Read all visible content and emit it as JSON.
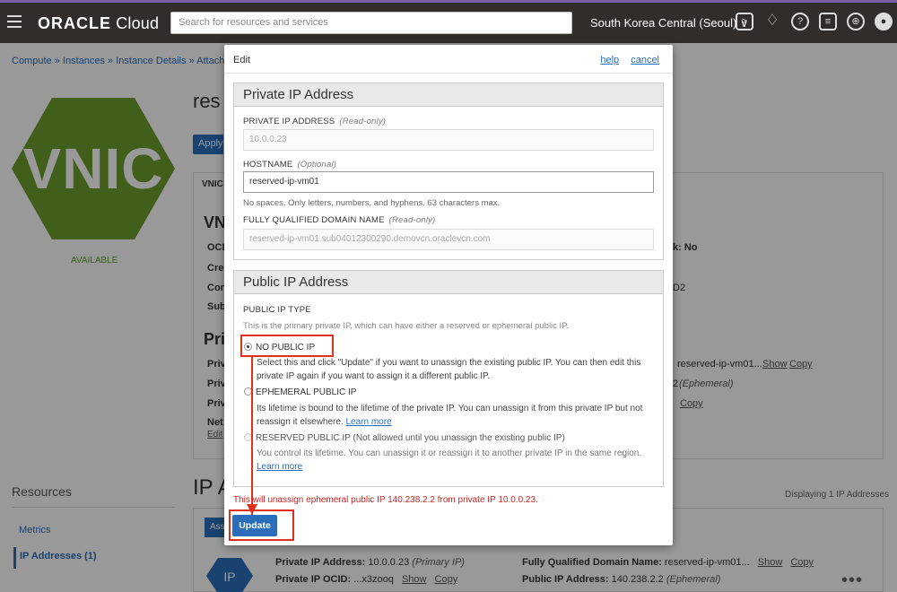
{
  "topbar": {
    "logo_brand": "ORACLE",
    "logo_product": "Cloud",
    "search_placeholder": "Search for resources and services",
    "region": "South Korea Central (Seoul) ∨",
    "icons": [
      "cloud-shell-icon",
      "bell-icon",
      "help-icon",
      "chat-icon",
      "globe-icon",
      "user-icon"
    ]
  },
  "breadcrumb": {
    "items": [
      "Compute",
      "Instances",
      "Instance Details",
      "Attached"
    ],
    "separator": "»"
  },
  "vnic": {
    "label": "VNIC",
    "status": "AVAILABLE",
    "status_color": "#5a9c2a",
    "hex_color": "#6d9e2e"
  },
  "background": {
    "title_partial": "res",
    "apply_partial": "Apply",
    "tab_partial": "VNIC",
    "section_partial": "VN",
    "rows_partial": [
      "OCI",
      "Cre",
      "Con",
      "Sub"
    ],
    "pri_heading_partial": "Pri",
    "pri_rows_partial": [
      "Priv",
      "Priv",
      "Priv"
    ],
    "net_partial": "Net",
    "edit_partial": "Edit",
    "right_k": "k:  No",
    "right_d2": "D2",
    "right_fqdn": "reserved-ip-vm01...",
    "right_ephemeral": "2",
    "ephemeral_label": "(Ephemeral)",
    "show": "Show",
    "copy": "Copy"
  },
  "resources": {
    "heading": "Resources",
    "items": [
      "Metrics",
      "IP Addresses (1)"
    ]
  },
  "ip_list": {
    "heading_partial": "IP A",
    "displaying": "Displaying 1 IP Addresses",
    "add_partial": "Ass",
    "icon_label": "IP",
    "private_ip_label": "Private IP Address:",
    "private_ip_value": "10.0.0.23",
    "private_ip_note": "(Primary IP)",
    "ocid_label": "Private IP OCID:",
    "ocid_value": "...x3zooq",
    "fqdn_label": "Fully Qualified Domain Name:",
    "fqdn_value": "reserved-ip-vm01...",
    "public_ip_label": "Public IP Address:",
    "public_ip_value": "140.238.2.2",
    "public_ip_note": "(Ephemeral)",
    "show": "Show",
    "copy": "Copy",
    "more": "•••"
  },
  "modal": {
    "title": "Edit",
    "help": "help",
    "cancel": "cancel",
    "private_section": {
      "heading": "Private IP Address",
      "ip_label": "PRIVATE IP ADDRESS",
      "ip_note": "(Read-only)",
      "ip_value": "10.0.0.23",
      "hostname_label": "HOSTNAME",
      "hostname_note": "(Optional)",
      "hostname_value": "reserved-ip-vm01",
      "hostname_hint": "No spaces. Only letters, numbers, and hyphens. 63 characters max.",
      "fqdn_label": "FULLY QUALIFIED DOMAIN NAME",
      "fqdn_note": "(Read-only)",
      "fqdn_value": "reserved-ip-vm01.sub04012300290.demovcn.oraclevcn.com"
    },
    "public_section": {
      "heading": "Public IP Address",
      "type_label": "PUBLIC IP TYPE",
      "type_hint": "This is the primary private IP, which can have either a reserved or ephemeral public IP.",
      "options": [
        {
          "label": "NO PUBLIC IP",
          "selected": true,
          "disabled": false,
          "desc": "Select this and click \"Update\" if you want to unassign the existing public IP. You can then edit this private IP again if you want to assign it a different public IP."
        },
        {
          "label": "EPHEMERAL PUBLIC IP",
          "selected": false,
          "disabled": false,
          "desc": "Its lifetime is bound to the lifetime of the private IP. You can unassign it from this private IP but not reassign it elsewhere.",
          "link": "Learn more"
        },
        {
          "label": "RESERVED PUBLIC IP (Not allowed until you unassign the existing public IP)",
          "selected": false,
          "disabled": true,
          "desc": "You control its lifetime. You can unassign it or reassign it to another private IP in the same region.",
          "link": "Learn more"
        }
      ]
    },
    "warning": "This will unassign ephemeral public IP 140.238.2.2 from private IP 10.0.0.23.",
    "update_button": "Update",
    "highlight_color": "#e0301e"
  }
}
